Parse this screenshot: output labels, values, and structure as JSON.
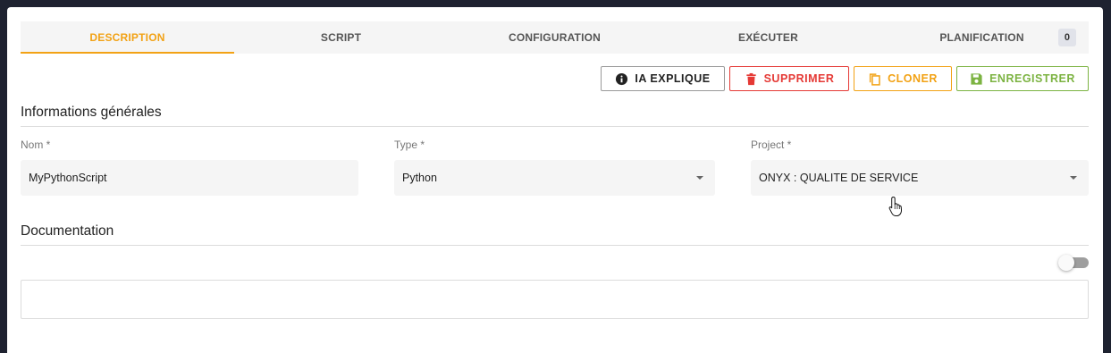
{
  "tabs": [
    {
      "label": "DESCRIPTION",
      "active": true
    },
    {
      "label": "SCRIPT",
      "active": false
    },
    {
      "label": "CONFIGURATION",
      "active": false
    },
    {
      "label": "EXÉCUTER",
      "active": false
    },
    {
      "label": "PLANIFICATION",
      "active": false,
      "badge": "0"
    }
  ],
  "toolbar": {
    "explain_label": "IA EXPLIQUE",
    "delete_label": "SUPPRIMER",
    "clone_label": "CLONER",
    "save_label": "ENREGISTRER"
  },
  "sections": {
    "general_title": "Informations générales",
    "documentation_title": "Documentation"
  },
  "form": {
    "name": {
      "label": "Nom *",
      "value": "MyPythonScript"
    },
    "type": {
      "label": "Type *",
      "value": "Python"
    },
    "project": {
      "label": "Project *",
      "value": "ONYX : QUALITE DE SERVICE"
    }
  },
  "documentation": {
    "toggle_on": false
  },
  "colors": {
    "accent": "#f2a215",
    "danger": "#e53935",
    "success": "#7cb342",
    "background": "#1e2230"
  },
  "icons": {
    "explain": "info-icon",
    "delete": "trash-icon",
    "clone": "copy-icon",
    "save": "floppy-disk-icon"
  }
}
